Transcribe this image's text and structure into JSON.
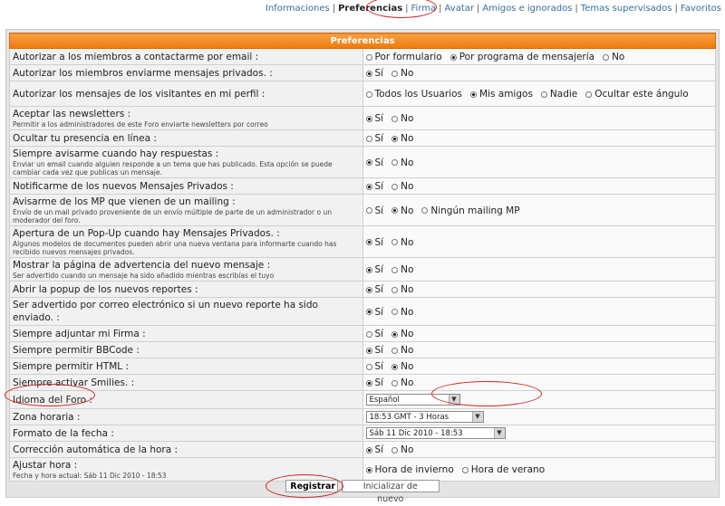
{
  "nav": {
    "items": [
      "Informaciones",
      "Preferencias",
      "Firma",
      "Avatar",
      "Amigos e ignorados",
      "Temas supervisados",
      "Favoritos"
    ],
    "active_index": 1
  },
  "header": {
    "title": "Preferencias"
  },
  "rows": [
    {
      "label": "Autorizar a los miembros a contactarme por email :",
      "options": [
        "Por formulario",
        "Por programa de mensajería",
        "No"
      ],
      "selected": 1
    },
    {
      "label": "Autorizar los miembros enviarme mensajes privados. :",
      "options": [
        "Sí",
        "No"
      ],
      "selected": 0
    },
    {
      "label": "Autorizar los mensajes de los visitantes en mi perfil :",
      "options": [
        "Todos los Usuarios",
        "Mis amigos",
        "Nadie",
        "Ocultar este ángulo"
      ],
      "selected": 1
    },
    {
      "label": "Aceptar las newsletters :",
      "desc": "Permitir a los administradores de este Foro enviarte newsletters por correo",
      "options": [
        "Sí",
        "No"
      ],
      "selected": 0
    },
    {
      "label": "Ocultar tu presencia en línea :",
      "options": [
        "Sí",
        "No"
      ],
      "selected": 1
    },
    {
      "label": "Siempre avisarme cuando hay respuestas :",
      "desc": "Enviar un email cuando alguien responde a un tema que has publicado. Esta opción se puede cambiar cada vez que publicas un mensaje.",
      "options": [
        "Sí",
        "No"
      ],
      "selected": 0
    },
    {
      "label": "Notificarme de los nuevos Mensajes Privados :",
      "options": [
        "Sí",
        "No"
      ],
      "selected": 0
    },
    {
      "label": "Avisarme de los MP que vienen de un mailing :",
      "desc": "Envío de un mail privado proveniente de un envío múltiple de parte de un administrador o un moderador del foro.",
      "options": [
        "Sí",
        "No",
        "Ningún mailing MP"
      ],
      "selected": 1
    },
    {
      "label": "Apertura de un Pop-Up cuando hay Mensajes Privados. :",
      "desc": "Algunos modelos de documentos pueden abrir una nueva ventana para informarte cuando has recibido nuevos mensajes privados.",
      "options": [
        "Sí",
        "No"
      ],
      "selected": 0
    },
    {
      "label": "Mostrar la página de advertencia del nuevo mensaje :",
      "desc": "Ser advertido cuando un mensaje ha sido añadido mientras escribías el tuyo",
      "options": [
        "Sí",
        "No"
      ],
      "selected": 0
    },
    {
      "label": "Abrir la popup de los nuevos reportes :",
      "options": [
        "Sí",
        "No"
      ],
      "selected": 0
    },
    {
      "label": "Ser advertido por correo electrónico si un nuevo reporte ha sido enviado. :",
      "options": [
        "Sí",
        "No"
      ],
      "selected": 0
    },
    {
      "label": "Siempre adjuntar mi Firma :",
      "options": [
        "Sí",
        "No"
      ],
      "selected": 1
    },
    {
      "label": "Siempre permitir BBCode :",
      "options": [
        "Sí",
        "No"
      ],
      "selected": 0
    },
    {
      "label": "Siempre permitir HTML :",
      "options": [
        "Sí",
        "No"
      ],
      "selected": 1
    },
    {
      "label": "Siempre activar Smilies. :",
      "options": [
        "Sí",
        "No"
      ],
      "selected": 0
    },
    {
      "label": "Idioma del Foro :",
      "select": "Español",
      "select_kind": "short"
    },
    {
      "label": "Zona horaria :",
      "select": "18:53 GMT - 3 Horas",
      "select_kind": "mid"
    },
    {
      "label": "Formato de la fecha :",
      "select": "Sáb 11 Dic 2010 - 18:53",
      "select_kind": "long"
    },
    {
      "label": "Corrección automática de la hora :",
      "options": [
        "Sí",
        "No"
      ],
      "selected": 0
    },
    {
      "label": "Ajustar hora :",
      "desc": "Fecha y hora actual: Sáb 11 Dic 2010 - 18:53",
      "options": [
        "Hora de invierno",
        "Hora de verano"
      ],
      "selected": 0
    }
  ],
  "buttons": {
    "submit": "Registrar",
    "reset": "Inicializar de nuevo"
  },
  "colors": {
    "header_orange": "#f58a1e",
    "link_blue": "#3a6d9a",
    "annotation_red": "#cc2222"
  }
}
